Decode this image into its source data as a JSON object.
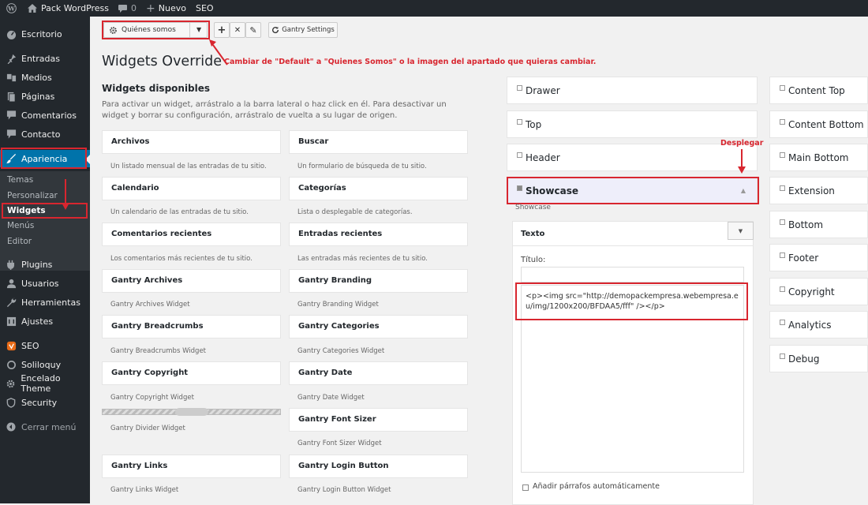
{
  "adminbar": {
    "site": "Pack WordPress",
    "comments": "0",
    "new": "Nuevo",
    "seo": "SEO"
  },
  "menu": {
    "escritorio": "Escritorio",
    "entradas": "Entradas",
    "medios": "Medios",
    "paginas": "Páginas",
    "comentarios": "Comentarios",
    "contacto": "Contacto",
    "apariencia": "Apariencia",
    "temas": "Temas",
    "personalizar": "Personalizar",
    "widgets": "Widgets",
    "menus": "Menús",
    "editor": "Editor",
    "plugins": "Plugins",
    "usuarios": "Usuarios",
    "herramientas": "Herramientas",
    "ajustes": "Ajustes",
    "seo": "SEO",
    "soliloquy": "Soliloquy",
    "encelado": "Encelado Theme",
    "security": "Security",
    "cerrar": "Cerrar menú"
  },
  "toolbar": {
    "override_select": "Quiénes somos",
    "add": "+",
    "remove": "✕",
    "edit": "✎",
    "gantry_settings": "Gantry Settings"
  },
  "page": {
    "title": "Widgets Override",
    "annotation": "Cambiar de \"Default\" a \"Quienes Somos\" o la imagen del apartado que quieras cambiar.",
    "available_heading": "Widgets disponibles",
    "available_desc": "Para activar un widget, arrástralo a la barra lateral o haz click en él. Para desactivar un widget y borrar su configuración, arrástralo de vuelta a su lugar de origen.",
    "desplegar": "Desplegar"
  },
  "widgets": {
    "archivos": {
      "title": "Archivos",
      "desc": "Un listado mensual de las entradas de tu sitio."
    },
    "buscar": {
      "title": "Buscar",
      "desc": "Un formulario de búsqueda de tu sitio."
    },
    "calendario": {
      "title": "Calendario",
      "desc": "Un calendario de las entradas de tu sitio."
    },
    "categorias": {
      "title": "Categorías",
      "desc": "Lista o desplegable de categorías."
    },
    "comentarios": {
      "title": "Comentarios recientes",
      "desc": "Los comentarios más recientes de tu sitio."
    },
    "entradas": {
      "title": "Entradas recientes",
      "desc": "Las entradas más recientes de tu sitio."
    },
    "g_archives": {
      "title": "Gantry Archives",
      "desc": "Gantry Archives Widget"
    },
    "g_branding": {
      "title": "Gantry Branding",
      "desc": "Gantry Branding Widget"
    },
    "g_breadcrumbs": {
      "title": "Gantry Breadcrumbs",
      "desc": "Gantry Breadcrumbs Widget"
    },
    "g_categories": {
      "title": "Gantry Categories",
      "desc": "Gantry Categories Widget"
    },
    "g_copyright": {
      "title": "Gantry Copyright",
      "desc": "Gantry Copyright Widget"
    },
    "g_date": {
      "title": "Gantry Date",
      "desc": "Gantry Date Widget"
    },
    "g_divider": {
      "desc": "Gantry Divider Widget"
    },
    "g_fontsizer": {
      "title": "Gantry Font Sizer",
      "desc": "Gantry Font Sizer Widget"
    },
    "g_links": {
      "title": "Gantry Links",
      "desc": "Gantry Links Widget"
    },
    "g_login": {
      "title": "Gantry Login Button",
      "desc": "Gantry Login Button Widget"
    }
  },
  "sidebars_left": {
    "drawer": "Drawer",
    "top": "Top",
    "header": "Header",
    "showcase": "Showcase",
    "showcase_desc": "Showcase"
  },
  "text_widget": {
    "title": "Texto",
    "titulo_label": "Título:",
    "content": "<p><img src=\"http://demopackempresa.webempresa.eu/img/1200x200/BFDAA5/fff\" /></p>",
    "autop": "Añadir párrafos automáticamente"
  },
  "sidebars_right": {
    "content_top": "Content Top",
    "content_bottom": "Content Bottom",
    "main_bottom": "Main Bottom",
    "extension": "Extension",
    "bottom": "Bottom",
    "footer": "Footer",
    "copyright": "Copyright",
    "analytics": "Analytics",
    "debug": "Debug"
  }
}
